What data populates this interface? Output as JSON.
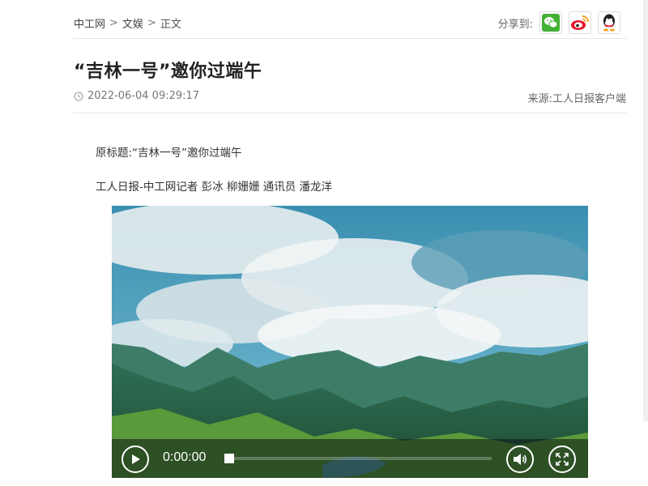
{
  "breadcrumb": {
    "items": [
      "中工网",
      "文娱",
      "正文"
    ],
    "separator": ">"
  },
  "share": {
    "label": "分享到:",
    "targets": [
      {
        "name": "wechat-icon",
        "color": "#44b035"
      },
      {
        "name": "weibo-icon",
        "color": "#e6162d"
      },
      {
        "name": "qq-icon",
        "color": "#1296db"
      }
    ]
  },
  "article": {
    "title": "“吉林一号”邀你过端午",
    "datetime": "2022-06-04 09:29:17",
    "source": "来源:工人日报客户端",
    "paragraphs": [
      "原标题:“吉林一号”邀你过端午",
      "工人日报-中工网记者 彭冰 柳姗姗 通讯员 潘龙洋"
    ]
  },
  "video": {
    "current_time": "0:00:00",
    "progress": 0
  }
}
